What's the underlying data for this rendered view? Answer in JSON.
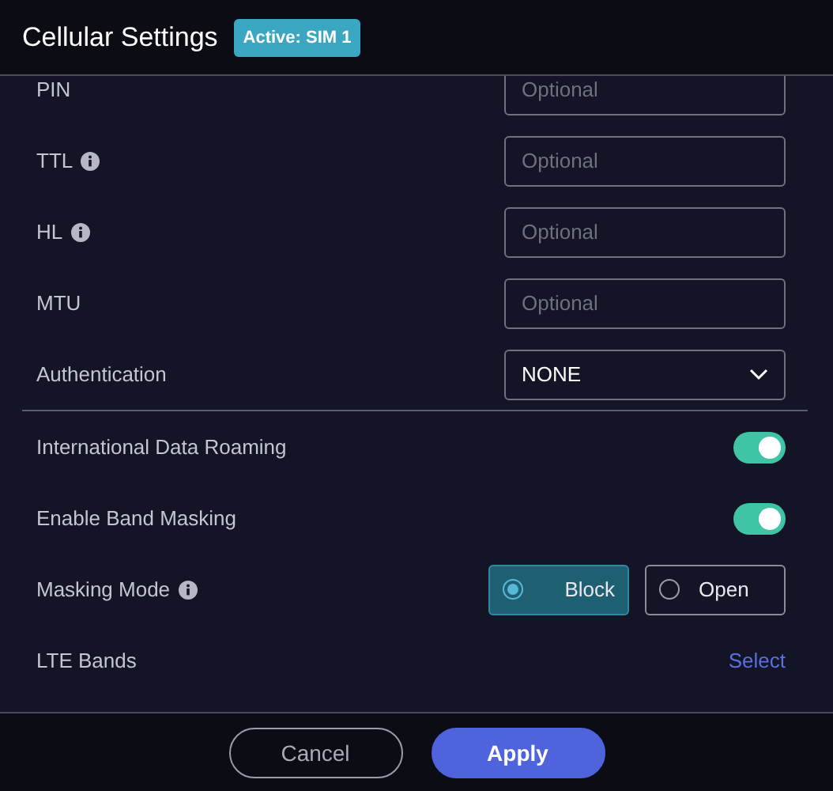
{
  "header": {
    "title": "Cellular Settings",
    "badge": "Active: SIM 1"
  },
  "rows": [
    {
      "kind": "input",
      "label": "PIN",
      "info": false,
      "placeholder": "Optional"
    },
    {
      "kind": "input",
      "label": "TTL",
      "info": true,
      "placeholder": "Optional"
    },
    {
      "kind": "input",
      "label": "HL",
      "info": true,
      "placeholder": "Optional"
    },
    {
      "kind": "input",
      "label": "MTU",
      "info": false,
      "placeholder": "Optional"
    },
    {
      "kind": "select",
      "label": "Authentication",
      "info": false,
      "value": "NONE"
    },
    {
      "kind": "divider"
    },
    {
      "kind": "toggle",
      "label": "International Data Roaming",
      "info": false,
      "on": true
    },
    {
      "kind": "toggle",
      "label": "Enable Band Masking",
      "info": false,
      "on": true
    },
    {
      "kind": "radio",
      "label": "Masking Mode",
      "info": true,
      "options": [
        {
          "label": "Block",
          "selected": true
        },
        {
          "label": "Open",
          "selected": false
        }
      ]
    },
    {
      "kind": "link",
      "label": "LTE Bands",
      "info": false,
      "link": "Select"
    }
  ],
  "footer": {
    "buttons": [
      {
        "label": "Cancel",
        "kind": "secondary"
      },
      {
        "label": "Apply",
        "kind": "primary"
      }
    ]
  }
}
